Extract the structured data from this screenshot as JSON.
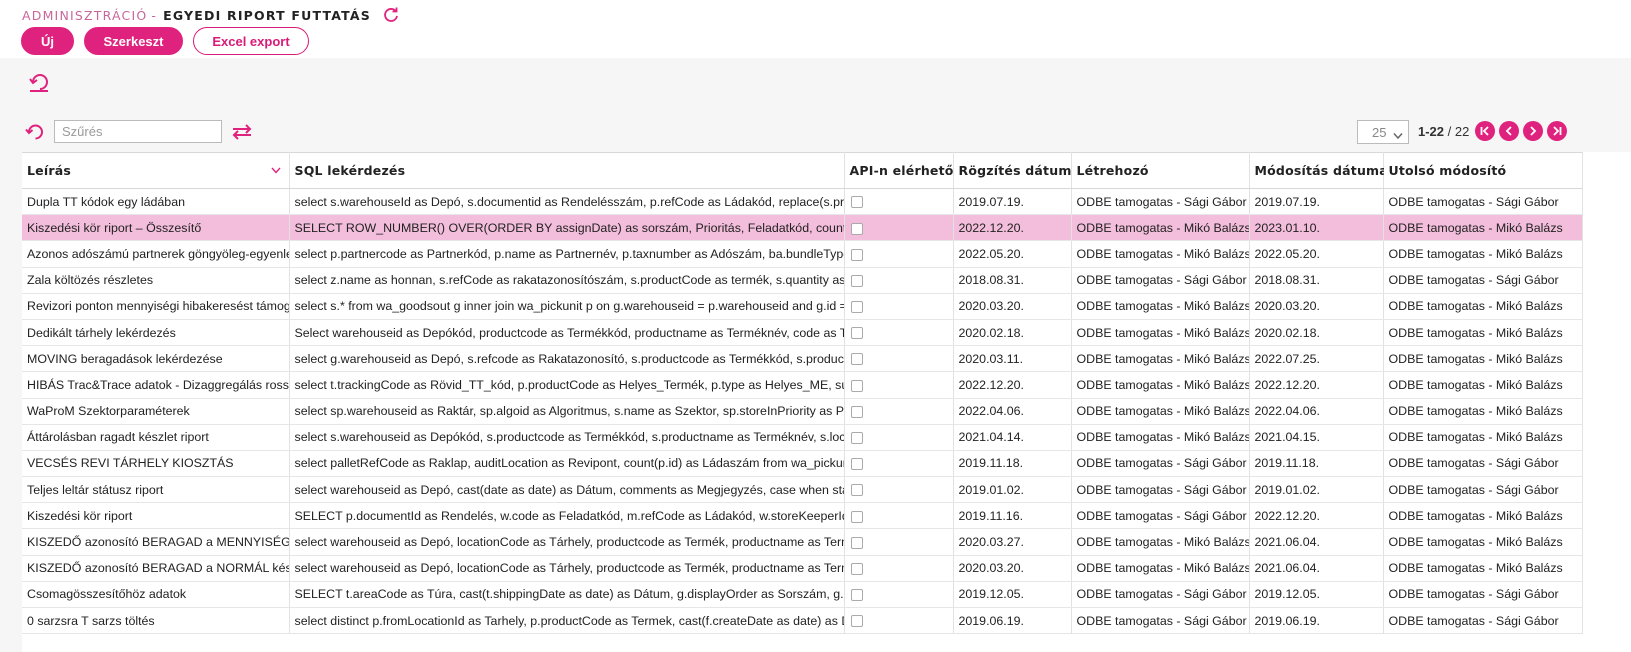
{
  "header": {
    "breadcrumb_admin": "ADMINISZTRÁCIÓ",
    "breadcrumb_separator": "-",
    "title": "EGYEDI RIPORT FUTTATÁS"
  },
  "toolbar": {
    "new_label": "Új",
    "edit_label": "Szerkeszt",
    "export_label": "Excel export"
  },
  "filter": {
    "placeholder": "Szűrés"
  },
  "pagination": {
    "page_size": "25",
    "range": "1-22",
    "total": "/ 22"
  },
  "columns": [
    "Leírás",
    "SQL lekérdezés",
    "API-n elérhető",
    "Rögzítés dátuma",
    "Létrehozó",
    "Módosítás dátuma",
    "Utolsó módosító"
  ],
  "rows": [
    [
      "Dupla TT kódok egy ládában",
      "select s.warehouseId as Depó, s.documentid as Rendelésszám, p.refCode as Ládakód, replace(s.productCode",
      "2019.07.19.",
      "ODBE tamogatas - Sági Gábor",
      "2019.07.19.",
      "ODBE tamogatas - Sági Gábor"
    ],
    [
      "Kiszedési kör riport – Összesítő",
      "SELECT ROW_NUMBER() OVER(ORDER BY assignDate) as sorszám, Prioritás, Feladatkód, count(Ládakód) as",
      "2022.12.20.",
      "ODBE tamogatas - Mikó Balázs",
      "2023.01.10.",
      "ODBE tamogatas - Mikó Balázs"
    ],
    [
      "Azonos adószámú partnerek göngyöleg-egyenlege",
      "select p.partnercode as Partnerkód, p.name as Partnernév, p.taxnumber as Adószám, ba.bundleTypeName",
      "2022.05.20.",
      "ODBE tamogatas - Mikó Balázs",
      "2022.05.20.",
      "ODBE tamogatas - Mikó Balázs"
    ],
    [
      "Zala költözés részletes",
      "select z.name as honnan, s.refCode as rakatazonosítószám, s.productCode as termék, s.quantity as mennyiség",
      "2018.08.31.",
      "ODBE tamogatas - Sági Gábor",
      "2018.08.31.",
      "ODBE tamogatas - Sági Gábor"
    ],
    [
      "Revizori ponton mennyiségi hibakeresést támogató",
      "select s.* from wa_goodsout g inner join wa_pickunit p on g.warehouseid = p.warehouseid and g.id = p.goodsoutid",
      "2020.03.20.",
      "ODBE tamogatas - Mikó Balázs",
      "2020.03.20.",
      "ODBE tamogatas - Mikó Balázs"
    ],
    [
      "Dedikált tárhely lekérdezés",
      "Select warehouseid as Depókód, productcode as Termékkód, productname as Terméknév, code as Tárhely",
      "2020.02.18.",
      "ODBE tamogatas - Mikó Balázs",
      "2020.02.18.",
      "ODBE tamogatas - Mikó Balázs"
    ],
    [
      "MOVING beragadások lekérdezése",
      "select g.warehouseid as Depó, s.refcode as Rakatazonosító, s.productcode as Termékkód, s.productname",
      "2020.03.11.",
      "ODBE tamogatas - Mikó Balázs",
      "2022.07.25.",
      "ODBE tamogatas - Mikó Balázs"
    ],
    [
      "HIBÁS Trac&Trace adatok - Dizaggregálás rossz terméken",
      "select t.trackingCode as Rövid_TT_kód, p.productCode as Helyes_Termék, p.type as Helyes_ME, substring",
      "2022.12.20.",
      "ODBE tamogatas - Mikó Balázs",
      "2022.12.20.",
      "ODBE tamogatas - Mikó Balázs"
    ],
    [
      "WaProM Szektorparaméterek",
      "select sp.warehouseid as Raktár, sp.algoid as Algoritmus, s.name as Szektor, sp.storeInPriority as Prioritás",
      "2022.04.06.",
      "ODBE tamogatas - Mikó Balázs",
      "2022.04.06.",
      "ODBE tamogatas - Mikó Balázs"
    ],
    [
      "Áttárolásban ragadt készlet riport",
      "select s.warehouseid as Depókód, s.productcode as Termékkód, s.productname as Terméknév, s.location",
      "2021.04.14.",
      "ODBE tamogatas - Mikó Balázs",
      "2021.04.15.",
      "ODBE tamogatas - Mikó Balázs"
    ],
    [
      "VECSÉS REVI TÁRHELY KIOSZTÁS",
      "select palletRefCode as Raklap, auditLocation as Revipont, count(p.id) as Ládaszám from wa_pickunit p",
      "2019.11.18.",
      "ODBE tamogatas - Sági Gábor",
      "2019.11.18.",
      "ODBE tamogatas - Sági Gábor"
    ],
    [
      "Teljes leltár státusz riport",
      "select warehouseid as Depó, cast(date as date) as Dátum, comments as Megjegyzés, case when status",
      "2019.01.02.",
      "ODBE tamogatas - Sági Gábor",
      "2019.01.02.",
      "ODBE tamogatas - Sági Gábor"
    ],
    [
      "Kiszedési kör riport",
      "SELECT p.documentId as Rendelés, w.code as Feladatkód, m.refCode as Ládakód, w.storeKeeperId as Raktáros",
      "2019.11.16.",
      "ODBE tamogatas - Sági Gábor",
      "2022.12.20.",
      "ODBE tamogatas - Mikó Balázs"
    ],
    [
      "KISZEDŐ azonosító BERAGAD a MENNYISÉGI FOGYÁS",
      "select warehouseid as Depó, locationCode as Tárhely, productcode as Termék, productname as Terméknév",
      "2020.03.27.",
      "ODBE tamogatas - Mikó Balázs",
      "2021.06.04.",
      "ODBE tamogatas - Mikó Balázs"
    ],
    [
      "KISZEDŐ azonosító BERAGAD a NORMÁL készletből",
      "select warehouseid as Depó, locationCode as Tárhely, productcode as Termék, productname as Terméknév",
      "2020.03.20.",
      "ODBE tamogatas - Mikó Balázs",
      "2021.06.04.",
      "ODBE tamogatas - Mikó Balázs"
    ],
    [
      "Csomagösszesítőhöz adatok",
      "SELECT t.areaCode as Túra, cast(t.shippingDate as date) as Dátum, g.displayOrder as Sorszám, g.partnerName",
      "2019.12.05.",
      "ODBE tamogatas - Sági Gábor",
      "2019.12.05.",
      "ODBE tamogatas - Sági Gábor"
    ],
    [
      "0 sarzsra T sarzs töltés",
      "select distinct p.fromLocationId as Tarhely, p.productCode as Termek, cast(f.createDate as date) as Datum",
      "2019.06.19.",
      "ODBE tamogatas - Sági Gábor",
      "2019.06.19.",
      "ODBE tamogatas - Sági Gábor"
    ]
  ],
  "selected_row": 1,
  "colors": {
    "accent": "#e0227f",
    "selected_row": "#f3bedb",
    "breadcrumb": "#c9669b"
  }
}
